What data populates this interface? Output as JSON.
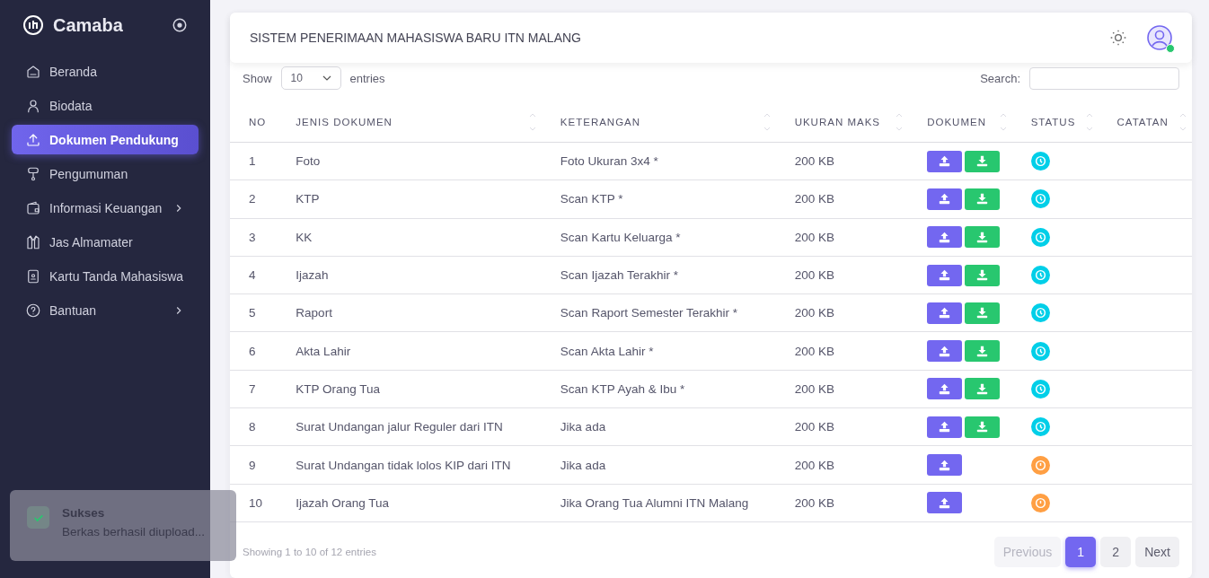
{
  "sidebar": {
    "brand": "Camaba",
    "items": [
      {
        "label": "Beranda",
        "selected": false,
        "has_submenu": false
      },
      {
        "label": "Biodata",
        "selected": false,
        "has_submenu": false
      },
      {
        "label": "Dokumen Pendukung",
        "selected": true,
        "has_submenu": false
      },
      {
        "label": "Pengumuman",
        "selected": false,
        "has_submenu": false
      },
      {
        "label": "Informasi Keuangan",
        "selected": false,
        "has_submenu": true
      },
      {
        "label": "Jas Almamater",
        "selected": false,
        "has_submenu": false
      },
      {
        "label": "Kartu Tanda Mahasiswa",
        "selected": false,
        "has_submenu": false
      },
      {
        "label": "Bantuan",
        "selected": false,
        "has_submenu": true
      }
    ]
  },
  "header": {
    "title": "SISTEM PENERIMAAN MAHASISWA BARU ITN MALANG",
    "user_online": true
  },
  "table_controls": {
    "show_label": "Show",
    "page_size": "10",
    "entries_label": "entries",
    "search_label": "Search:"
  },
  "table": {
    "columns": [
      "NO",
      "JENIS DOKUMEN",
      "KETERANGAN",
      "UKURAN MAKS",
      "DOKUMEN",
      "STATUS",
      "CATATAN"
    ],
    "rows": [
      {
        "no": "1",
        "jenis": "Foto",
        "keterangan": "Foto Ukuran 3x4 *",
        "ukuran": "200 KB",
        "can_download": true,
        "uploaded": true
      },
      {
        "no": "2",
        "jenis": "KTP",
        "keterangan": "Scan KTP *",
        "ukuran": "200 KB",
        "can_download": true,
        "uploaded": true
      },
      {
        "no": "3",
        "jenis": "KK",
        "keterangan": "Scan Kartu Keluarga *",
        "ukuran": "200 KB",
        "can_download": true,
        "uploaded": true
      },
      {
        "no": "4",
        "jenis": "Ijazah",
        "keterangan": "Scan Ijazah Terakhir *",
        "ukuran": "200 KB",
        "can_download": true,
        "uploaded": true
      },
      {
        "no": "5",
        "jenis": "Raport",
        "keterangan": "Scan Raport Semester Terakhir *",
        "ukuran": "200 KB",
        "can_download": true,
        "uploaded": true
      },
      {
        "no": "6",
        "jenis": "Akta Lahir",
        "keterangan": "Scan Akta Lahir *",
        "ukuran": "200 KB",
        "can_download": true,
        "uploaded": true
      },
      {
        "no": "7",
        "jenis": "KTP Orang Tua",
        "keterangan": "Scan KTP Ayah & Ibu *",
        "ukuran": "200 KB",
        "can_download": true,
        "uploaded": true
      },
      {
        "no": "8",
        "jenis": "Surat Undangan jalur Reguler dari ITN",
        "keterangan": "Jika ada",
        "ukuran": "200 KB",
        "can_download": true,
        "uploaded": true
      },
      {
        "no": "9",
        "jenis": "Surat Undangan tidak lolos KIP dari ITN",
        "keterangan": "Jika ada",
        "ukuran": "200 KB",
        "can_download": false,
        "uploaded": false
      },
      {
        "no": "10",
        "jenis": "Ijazah Orang Tua",
        "keterangan": "Jika Orang Tua Alumni ITN Malang",
        "ukuran": "200 KB",
        "can_download": false,
        "uploaded": false
      }
    ]
  },
  "footer": {
    "info": "Showing 1 to 10 of 12 entries",
    "previous": {
      "label": "Previous",
      "disabled": true
    },
    "pages": [
      {
        "label": "1",
        "selected": true
      },
      {
        "label": "2",
        "selected": false
      }
    ],
    "next": {
      "label": "Next",
      "disabled": false
    }
  },
  "toast": {
    "title": "Sukses",
    "message": "Berkas berhasil diupload..."
  }
}
